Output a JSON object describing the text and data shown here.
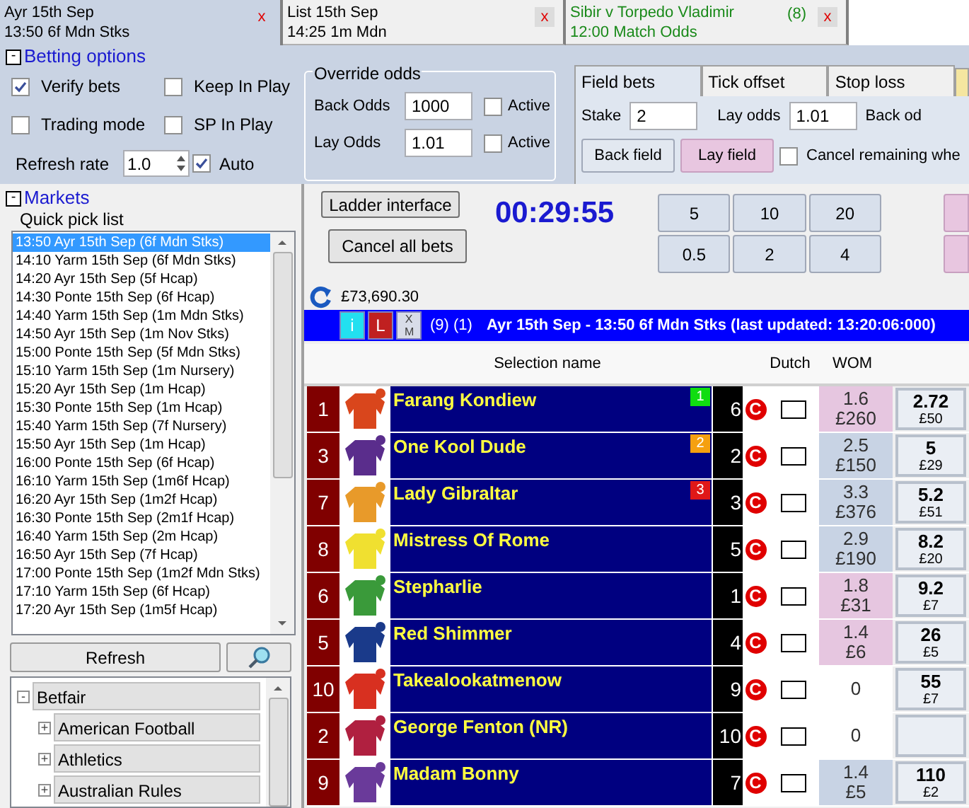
{
  "tabs": [
    {
      "line1": "Ayr 15th Sep",
      "line2": "13:50 6f Mdn Stks",
      "close": "x",
      "kind": "market",
      "selected": true
    },
    {
      "line1": "List 15th Sep",
      "line2": "14:25 1m Mdn",
      "close": "x",
      "kind": "market",
      "selected": false
    },
    {
      "line1": "Sibir v Torpedo Vladimir",
      "line2": "12:00 Match Odds",
      "count": "(8)",
      "close": "x",
      "kind": "inplay",
      "selected": false
    }
  ],
  "betting_options": {
    "toggle": "-",
    "title": "Betting options",
    "checks": [
      {
        "label": "Verify bets",
        "checked": true
      },
      {
        "label": "Keep In Play",
        "checked": false
      },
      {
        "label": "Trading mode",
        "checked": false
      },
      {
        "label": "SP In Play",
        "checked": false
      }
    ],
    "refresh_rate": {
      "label": "Refresh rate",
      "value": "1.0"
    },
    "auto": {
      "label": "Auto",
      "checked": true
    },
    "override_odds": {
      "title": "Override odds",
      "rows": [
        {
          "label": "Back Odds",
          "value": "1000",
          "active_label": "Active",
          "checked": false
        },
        {
          "label": "Lay Odds",
          "value": "1.01",
          "active_label": "Active",
          "checked": false
        }
      ]
    },
    "field_tabs": [
      {
        "label": "Field bets",
        "selected": true
      },
      {
        "label": "Tick offset",
        "selected": false
      },
      {
        "label": "Stop loss",
        "selected": false
      }
    ],
    "stake": {
      "label": "Stake",
      "value": "2"
    },
    "lay_odds": {
      "label": "Lay odds",
      "value": "1.01"
    },
    "back_odds_label": "Back od",
    "buttons": [
      {
        "label": "Back field",
        "kind": "back"
      },
      {
        "label": "Lay field",
        "kind": "lay"
      }
    ],
    "cancel_remaining": {
      "label": "Cancel remaining whe",
      "checked": false
    }
  },
  "markets": {
    "toggle": "-",
    "title": "Markets",
    "quick_pick": {
      "title": "Quick pick list",
      "items": [
        {
          "label": "13:50 Ayr 15th Sep (6f Mdn Stks)",
          "selected": true
        },
        {
          "label": "14:10 Yarm 15th Sep (6f Mdn Stks)",
          "selected": false
        },
        {
          "label": "14:20 Ayr 15th Sep (5f Hcap)",
          "selected": false
        },
        {
          "label": "14:30 Ponte 15th Sep (6f Hcap)",
          "selected": false
        },
        {
          "label": "14:40 Yarm 15th Sep (1m Mdn Stks)",
          "selected": false
        },
        {
          "label": "14:50 Ayr 15th Sep (1m Nov Stks)",
          "selected": false
        },
        {
          "label": "15:00 Ponte 15th Sep (5f Mdn Stks)",
          "selected": false
        },
        {
          "label": "15:10 Yarm 15th Sep (1m Nursery)",
          "selected": false
        },
        {
          "label": "15:20 Ayr 15th Sep (1m Hcap)",
          "selected": false
        },
        {
          "label": "15:30 Ponte 15th Sep (1m Hcap)",
          "selected": false
        },
        {
          "label": "15:40 Yarm 15th Sep (7f Nursery)",
          "selected": false
        },
        {
          "label": "15:50 Ayr 15th Sep (1m Hcap)",
          "selected": false
        },
        {
          "label": "16:00 Ponte 15th Sep (6f Hcap)",
          "selected": false
        },
        {
          "label": "16:10 Yarm 15th Sep (1m6f Hcap)",
          "selected": false
        },
        {
          "label": "16:20 Ayr 15th Sep (1m2f Hcap)",
          "selected": false
        },
        {
          "label": "16:30 Ponte 15th Sep (2m1f Hcap)",
          "selected": false
        },
        {
          "label": "16:40 Yarm 15th Sep (2m Hcap)",
          "selected": false
        },
        {
          "label": "16:50 Ayr 15th Sep (7f Hcap)",
          "selected": false
        },
        {
          "label": "17:00 Ponte 15th Sep (1m2f Mdn Stks)",
          "selected": false
        },
        {
          "label": "17:10 Yarm 15th Sep (6f Hcap)",
          "selected": false
        },
        {
          "label": "17:20 Ayr 15th Sep (1m5f Hcap)",
          "selected": false
        }
      ]
    },
    "refresh_button": "Refresh",
    "tree": {
      "label": "Betfair",
      "toggle": "-",
      "children": [
        {
          "label": "American Football",
          "toggle": "+"
        },
        {
          "label": "Athletics",
          "toggle": "+"
        },
        {
          "label": "Australian Rules",
          "toggle": "+"
        }
      ]
    }
  },
  "ladder": {
    "ladder_button": "Ladder interface",
    "cancel_button": "Cancel all bets",
    "timer": "00:29:55",
    "stakes": [
      "5",
      "10",
      "20",
      "0.5",
      "2",
      "4"
    ],
    "balance": "£73,690.30",
    "info_bar": {
      "buttons": [
        {
          "label": "i",
          "kind": "info"
        },
        {
          "label": "L",
          "kind": "lay"
        },
        {
          "label": "X M",
          "kind": "xm"
        }
      ],
      "counts": "(9) (1)",
      "title": "Ayr 15th Sep - 13:50 6f Mdn Stks (last updated: 13:20:06:000)"
    }
  },
  "grid": {
    "columns": {
      "selection": "Selection name",
      "dutch": "Dutch",
      "wom": "WOM"
    },
    "rows": [
      {
        "number": "1",
        "silk": {
          "color": "#d9461c"
        },
        "name": "Farang Kondiew",
        "rank": {
          "text": "1",
          "color": "#10dd10"
        },
        "cloth": "6",
        "cancel": "C",
        "dutch_checked": false,
        "wom": {
          "odds": "1.6",
          "amount": "£260",
          "color": "#e6c6e0"
        },
        "back": {
          "odds": "2.72",
          "amount": "£50"
        }
      },
      {
        "number": "3",
        "silk": {
          "color": "#5a2d8c"
        },
        "name": "One Kool Dude",
        "rank": {
          "text": "2",
          "color": "#f5a010"
        },
        "cloth": "2",
        "cancel": "C",
        "dutch_checked": false,
        "wom": {
          "odds": "2.5",
          "amount": "£150",
          "color": "#c8d3e4"
        },
        "back": {
          "odds": "5",
          "amount": "£29"
        }
      },
      {
        "number": "7",
        "silk": {
          "color": "#e89a2a"
        },
        "name": "Lady Gibraltar",
        "rank": {
          "text": "3",
          "color": "#e01818"
        },
        "cloth": "3",
        "cancel": "C",
        "dutch_checked": false,
        "wom": {
          "odds": "3.3",
          "amount": "£376",
          "color": "#c8d3e4"
        },
        "back": {
          "odds": "5.2",
          "amount": "£51"
        }
      },
      {
        "number": "8",
        "silk": {
          "color": "#f0e030"
        },
        "name": "Mistress Of Rome",
        "cloth": "5",
        "cancel": "C",
        "dutch_checked": false,
        "wom": {
          "odds": "2.9",
          "amount": "£190",
          "color": "#c8d3e4"
        },
        "back": {
          "odds": "8.2",
          "amount": "£20"
        }
      },
      {
        "number": "6",
        "silk": {
          "color": "#3a9a3a"
        },
        "name": "Stepharlie",
        "cloth": "1",
        "cancel": "C",
        "dutch_checked": false,
        "wom": {
          "odds": "1.8",
          "amount": "£31",
          "color": "#e6c6e0"
        },
        "back": {
          "odds": "9.2",
          "amount": "£7"
        }
      },
      {
        "number": "5",
        "silk": {
          "color": "#1a3a8a"
        },
        "name": "Red Shimmer",
        "cloth": "4",
        "cancel": "C",
        "dutch_checked": false,
        "wom": {
          "odds": "1.4",
          "amount": "£6",
          "color": "#e6c6e0"
        },
        "back": {
          "odds": "26",
          "amount": "£5"
        }
      },
      {
        "number": "10",
        "silk": {
          "color": "#d83020"
        },
        "name": "Takealookatmenow",
        "cloth": "9",
        "cancel": "C",
        "dutch_checked": false,
        "wom": {
          "odds": "0",
          "color": "#ffffff"
        },
        "back": {
          "odds": "55",
          "amount": "£7"
        }
      },
      {
        "number": "2",
        "silk": {
          "color": "#b02040"
        },
        "name": "George Fenton (NR)",
        "cloth": "10",
        "cancel": "C",
        "dutch_checked": false,
        "wom": {
          "odds": "0",
          "color": "#ffffff"
        }
      },
      {
        "number": "9",
        "silk": {
          "color": "#6a3a9a"
        },
        "name": "Madam Bonny",
        "cloth": "7",
        "cancel": "C",
        "dutch_checked": false,
        "wom": {
          "odds": "1.4",
          "amount": "£5",
          "color": "#c8d3e4"
        },
        "back": {
          "odds": "110",
          "amount": "£2"
        }
      }
    ]
  }
}
